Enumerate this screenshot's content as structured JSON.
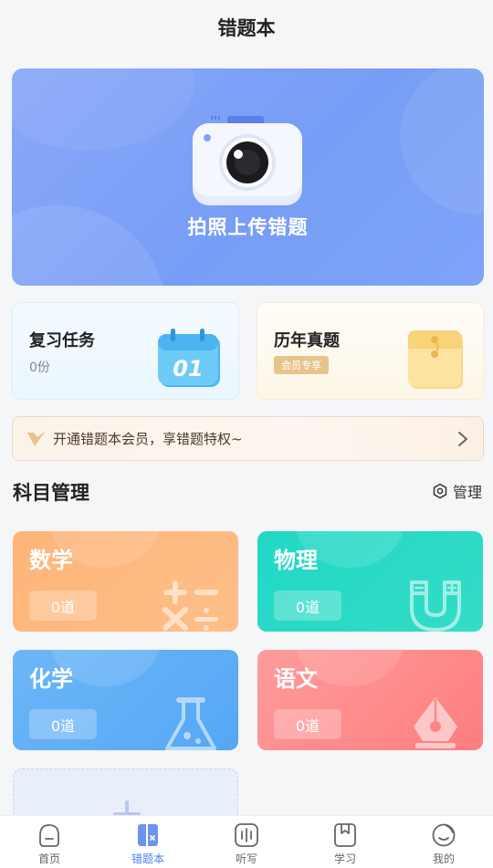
{
  "header": {
    "title": "错题本"
  },
  "hero": {
    "label": "拍照上传错题",
    "icon": "camera-icon"
  },
  "cards": {
    "review": {
      "title": "复习任务",
      "count": "0份",
      "icon": "calendar-icon",
      "icon_text": "01"
    },
    "exam": {
      "title": "历年真题",
      "badge": "会员专享",
      "icon": "folder-icon"
    }
  },
  "banner": {
    "text": "开通错题本会员，享错题特权~",
    "icon": "vip-v-icon"
  },
  "subjects_section": {
    "title": "科目管理",
    "manage_label": "管理"
  },
  "subjects": [
    {
      "name": "数学",
      "count": "0道",
      "icon": "math-symbols-icon",
      "color": "#fdb479"
    },
    {
      "name": "物理",
      "count": "0道",
      "icon": "magnet-icon",
      "color": "#22d8c5"
    },
    {
      "name": "化学",
      "count": "0道",
      "icon": "flask-icon",
      "color": "#6db6f7"
    },
    {
      "name": "语文",
      "count": "0道",
      "icon": "pen-nib-icon",
      "color": "#ff9b9b"
    }
  ],
  "tabs": [
    {
      "label": "首页",
      "icon": "home-icon"
    },
    {
      "label": "错题本",
      "icon": "wrongbook-icon",
      "active": true
    },
    {
      "label": "听写",
      "icon": "dictation-icon"
    },
    {
      "label": "学习",
      "icon": "study-icon"
    },
    {
      "label": "我的",
      "icon": "profile-icon"
    }
  ],
  "colors": {
    "accent": "#4f7ef1",
    "hero": "#7fa2f7",
    "vip_gold": "#e8c48d"
  }
}
